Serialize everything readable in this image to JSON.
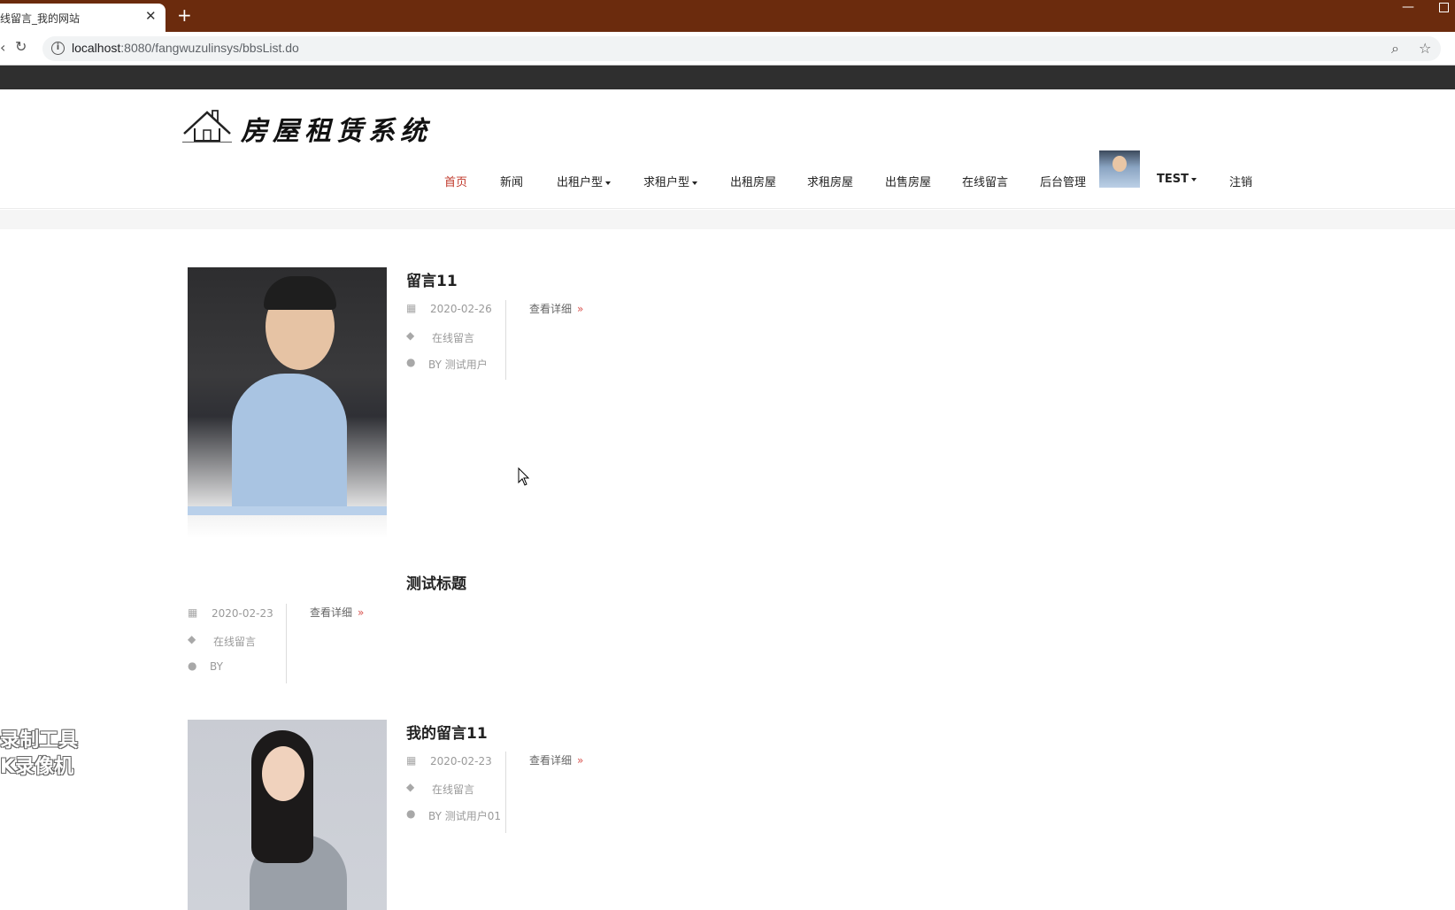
{
  "browser": {
    "tab_title": "线留言_我的网站",
    "tab_close": "✕",
    "new_tab": "+",
    "url_host": "localhost",
    "url_rest": ":8080/fangwuzulinsys/bbsList.do",
    "minimize": "—"
  },
  "site": {
    "logo_text": "房屋租赁系统"
  },
  "nav": {
    "home": "首页",
    "news": "新闻",
    "rent_type": "出租户型",
    "seek_type": "求租户型",
    "rent_house": "出租房屋",
    "seek_house": "求租房屋",
    "sale_house": "出售房屋",
    "message": "在线留言",
    "admin": "后台管理",
    "user": "TEST",
    "logout": "注销"
  },
  "posts": [
    {
      "title": "留言11",
      "date": "2020-02-26",
      "category": "在线留言",
      "author": "BY 测试用户",
      "detail": "查看详细"
    },
    {
      "title": "测试标题",
      "date": "2020-02-23",
      "category": "在线留言",
      "author": "BY",
      "detail": "查看详细"
    },
    {
      "title": "我的留言11",
      "date": "2020-02-23",
      "category": "在线留言",
      "author": "BY 测试用户01",
      "detail": "查看详细"
    }
  ],
  "overlay": {
    "line1": "录制工具",
    "line2": "K录像机"
  },
  "colors": {
    "titlebar": "#6b2b0d",
    "active_nav": "#c0392b",
    "raquo": "#d9534f"
  }
}
